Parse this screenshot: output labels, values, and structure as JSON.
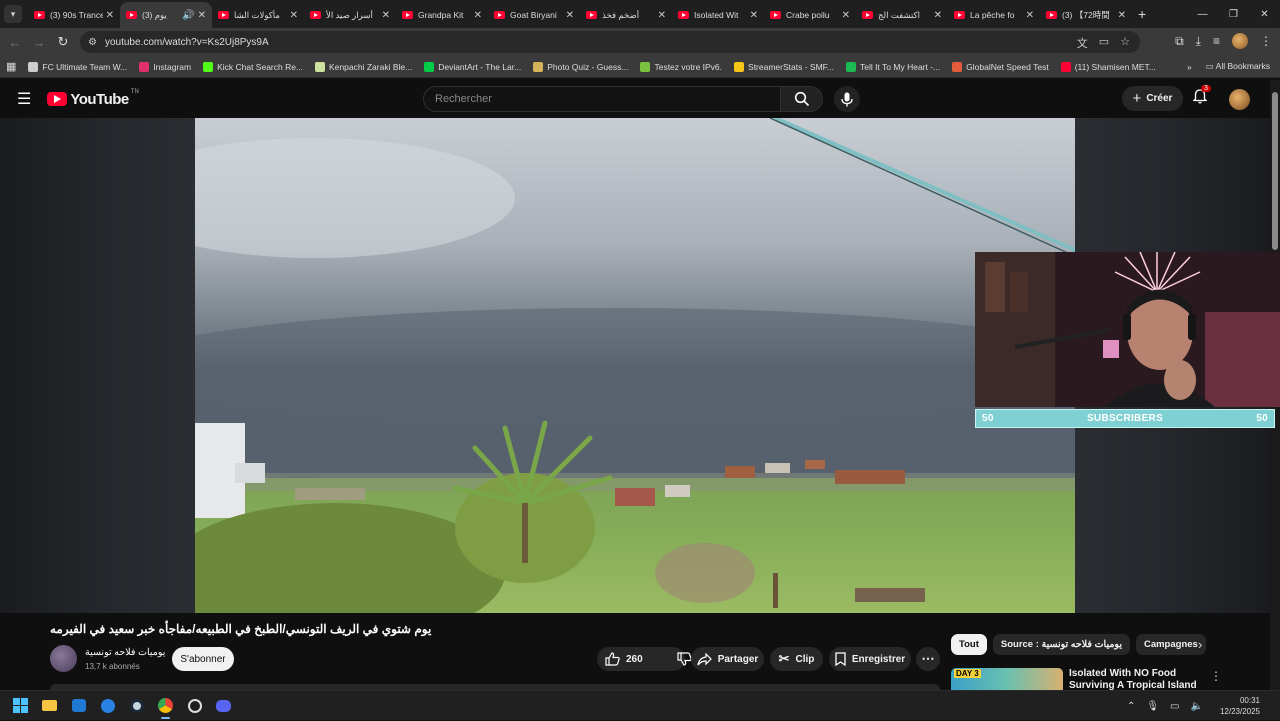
{
  "browser": {
    "tabs": [
      {
        "title": "(3) 90s Trance",
        "active": false,
        "audio": false
      },
      {
        "title": "(3) يوم",
        "active": true,
        "audio": true
      },
      {
        "title": "مأكولات الشا",
        "active": false,
        "audio": false
      },
      {
        "title": "أسرار صيد الأ",
        "active": false,
        "audio": false
      },
      {
        "title": "Grandpa Kit",
        "active": false,
        "audio": false
      },
      {
        "title": "Goat Biryani",
        "active": false,
        "audio": false
      },
      {
        "title": "أضخم فخذ",
        "active": false,
        "audio": false
      },
      {
        "title": "Isolated Wit",
        "active": false,
        "audio": false
      },
      {
        "title": "Crabe poilu",
        "active": false,
        "audio": false
      },
      {
        "title": "اكتشفت الج",
        "active": false,
        "audio": false
      },
      {
        "title": "La pêche fo",
        "active": false,
        "audio": false
      },
      {
        "title": "(3) 【72時間",
        "active": false,
        "audio": false
      }
    ],
    "url": "youtube.com/watch?v=Ks2Uj8Pys9A",
    "bookmarks": [
      {
        "label": "FC Ultimate Team W...",
        "color": "#cccccc"
      },
      {
        "label": "Instagram",
        "color": "#e1306c"
      },
      {
        "label": "Kick Chat Search Re...",
        "color": "#53fc18"
      },
      {
        "label": "Kenpachi Zaraki Ble...",
        "color": "#cfe3a0"
      },
      {
        "label": "DeviantArt - The Lar...",
        "color": "#05cc47"
      },
      {
        "label": "Photo Quiz - Guess...",
        "color": "#d4b35a"
      },
      {
        "label": "Testez votre IPv6.",
        "color": "#7cc040"
      },
      {
        "label": "StreamerStats - SMF...",
        "color": "#f5c518"
      },
      {
        "label": "Tell It To My Heart -...",
        "color": "#1db954"
      },
      {
        "label": "GlobalNet Speed Test",
        "color": "#e25b3a"
      },
      {
        "label": "(11) Shamisen MET...",
        "color": "#ff0033"
      }
    ],
    "all_bookmarks": "All Bookmarks"
  },
  "youtube": {
    "logo_text": "YouTube",
    "logo_country": "TN",
    "search_placeholder": "Rechercher",
    "create_label": "Créer",
    "notification_count": "3",
    "video_title": "يوم شتوي في الريف التونسي/الطبخ في الطبيعه/مفاجأه خبر سعيد في الفيرمه",
    "channel_name": "يوميات فلاحه تونسية",
    "channel_subs": "13,7 k abonnés",
    "subscribe_label": "S'abonner",
    "likes": "260",
    "share_label": "Partager",
    "clip_label": "Clip",
    "save_label": "Enregistrer",
    "chips": [
      "Tout",
      "Source : يوميات فلاحه تونسية",
      "Campagnes"
    ],
    "rec_title": "Isolated With NO Food Surviving A Tropical Island",
    "rec_badge": "DAY 3"
  },
  "overlay": {
    "sub_left": "50",
    "sub_label": "SUBSCRIBERS",
    "sub_right": "50"
  },
  "taskbar": {
    "time": "00:31",
    "date": "12/23/2025"
  }
}
